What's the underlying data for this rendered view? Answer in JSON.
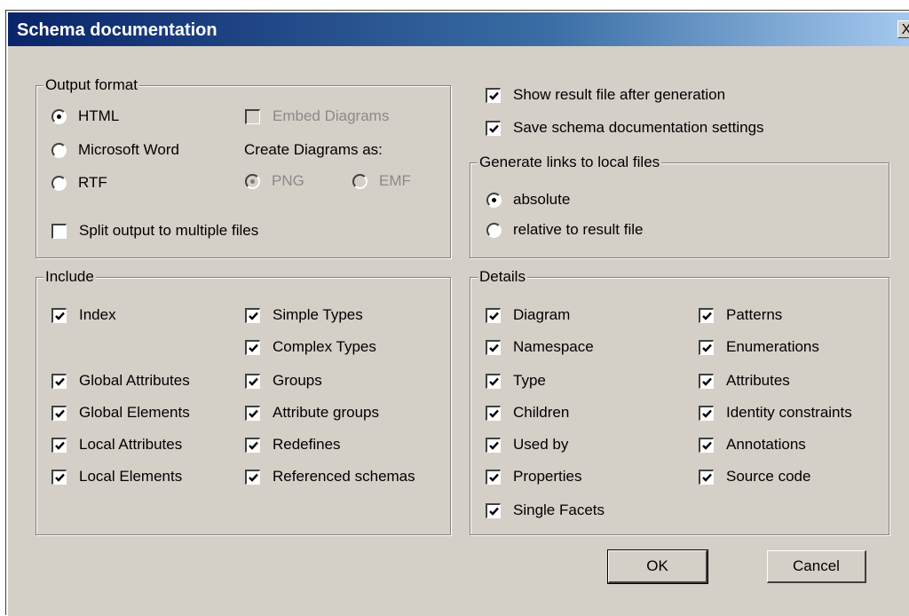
{
  "window": {
    "title": "Schema documentation",
    "close_label": "X"
  },
  "output_format": {
    "legend": "Output format",
    "html": "HTML",
    "word": "Microsoft Word",
    "rtf": "RTF",
    "selected": "HTML",
    "embed_diagrams": {
      "label": "Embed Diagrams",
      "checked": false,
      "enabled": false
    },
    "create_diagrams_label": "Create Diagrams as:",
    "png": "PNG",
    "emf": "EMF",
    "diagram_format_selected": "PNG",
    "split_output": {
      "label": "Split output to multiple files",
      "checked": false
    }
  },
  "options": {
    "show_result": {
      "label": "Show result file after generation",
      "checked": true
    },
    "save_settings": {
      "label": "Save schema documentation settings",
      "checked": true
    }
  },
  "links": {
    "legend": "Generate links to local files",
    "absolute": "absolute",
    "relative": "relative to result file",
    "selected": "absolute"
  },
  "include": {
    "legend": "Include",
    "index": "Index",
    "simple_types": "Simple Types",
    "complex_types": "Complex Types",
    "global_attributes": "Global Attributes",
    "groups": "Groups",
    "global_elements": "Global Elements",
    "attribute_groups": "Attribute groups",
    "local_attributes": "Local Attributes",
    "redefines": "Redefines",
    "local_elements": "Local Elements",
    "referenced_schemas": "Referenced schemas",
    "all_checked": true
  },
  "details": {
    "legend": "Details",
    "diagram": "Diagram",
    "patterns": "Patterns",
    "namespace": "Namespace",
    "enumerations": "Enumerations",
    "type": "Type",
    "attributes": "Attributes",
    "children": "Children",
    "identity_constraints": "Identity constraints",
    "used_by": "Used by",
    "annotations": "Annotations",
    "properties": "Properties",
    "source_code": "Source code",
    "single_facets": "Single Facets",
    "all_checked": true
  },
  "buttons": {
    "ok": "OK",
    "cancel": "Cancel"
  }
}
